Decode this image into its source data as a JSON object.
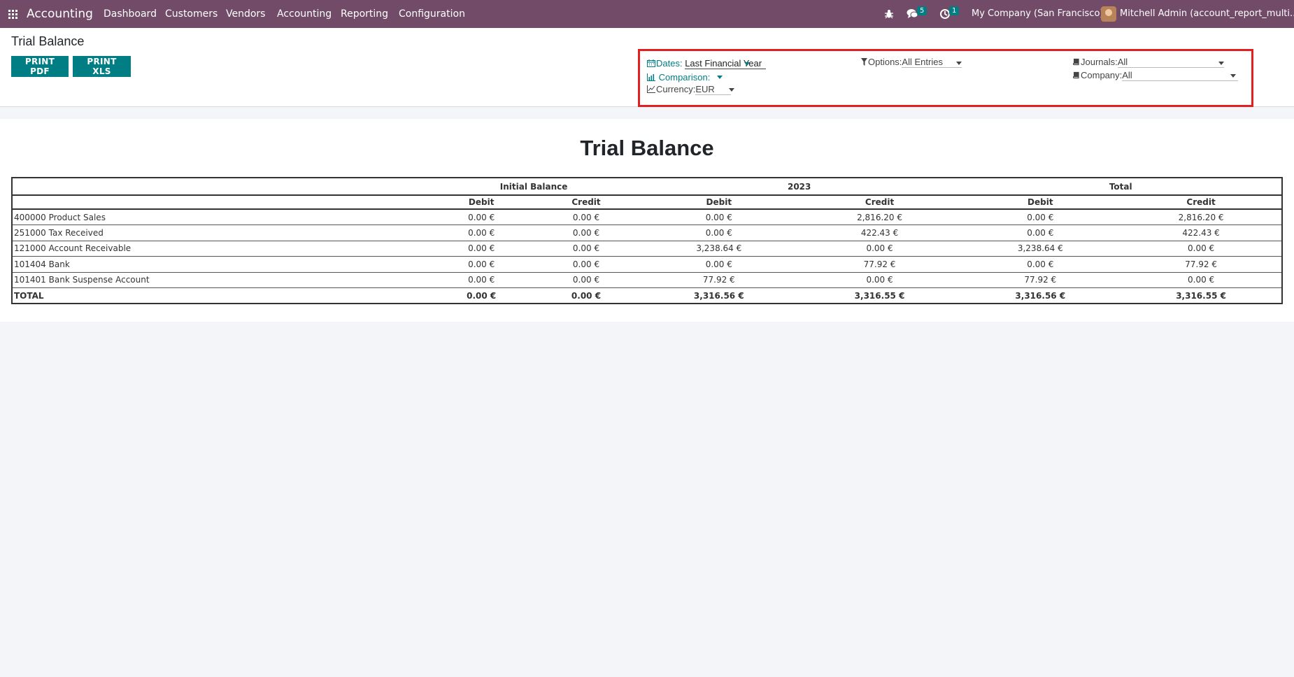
{
  "navbar": {
    "app_name": "Accounting",
    "menu": [
      "Dashboard",
      "Customers",
      "Vendors",
      "Accounting",
      "Reporting",
      "Configuration"
    ],
    "messages_count": "5",
    "activities_count": "1",
    "company": "My Company (San Francisco)",
    "user": "Mitchell Admin (account_report_multi..."
  },
  "control_panel": {
    "title": "Trial Balance",
    "print_pdf": "PRINT PDF",
    "print_xls": "PRINT XLS"
  },
  "filters": {
    "dates_label": "Dates:",
    "dates_value": "Last Financial Year",
    "comparison_label": "Comparison:",
    "currency_label": "Currency:",
    "currency_value": "EUR",
    "options_label": "Options:",
    "options_value": "All Entries",
    "journals_label": "Journals:",
    "journals_value": "All",
    "company_label": "Company:",
    "company_value": "All"
  },
  "report": {
    "title": "Trial Balance",
    "groups": [
      "Initial Balance",
      "2023",
      "Total"
    ],
    "columns": [
      "Debit",
      "Credit",
      "Debit",
      "Credit",
      "Debit",
      "Credit"
    ],
    "rows": [
      {
        "name": "400000 Product Sales",
        "values": [
          "0.00 €",
          "0.00 €",
          "0.00 €",
          "2,816.20 €",
          "0.00 €",
          "2,816.20 €"
        ]
      },
      {
        "name": "251000 Tax Received",
        "values": [
          "0.00 €",
          "0.00 €",
          "0.00 €",
          "422.43 €",
          "0.00 €",
          "422.43 €"
        ]
      },
      {
        "name": "121000 Account Receivable",
        "values": [
          "0.00 €",
          "0.00 €",
          "3,238.64 €",
          "0.00 €",
          "3,238.64 €",
          "0.00 €"
        ]
      },
      {
        "name": "101404 Bank",
        "values": [
          "0.00 €",
          "0.00 €",
          "0.00 €",
          "77.92 €",
          "0.00 €",
          "77.92 €"
        ]
      },
      {
        "name": "101401 Bank Suspense Account",
        "values": [
          "0.00 €",
          "0.00 €",
          "77.92 €",
          "0.00 €",
          "77.92 €",
          "0.00 €"
        ]
      }
    ],
    "total": {
      "name": "TOTAL",
      "values": [
        "0.00 €",
        "0.00 €",
        "3,316.56 €",
        "3,316.55 €",
        "3,316.56 €",
        "3,316.55 €"
      ]
    }
  },
  "colors": {
    "navbar": "#714b67",
    "accent": "#017e84",
    "highlight_border": "#e1201f"
  }
}
